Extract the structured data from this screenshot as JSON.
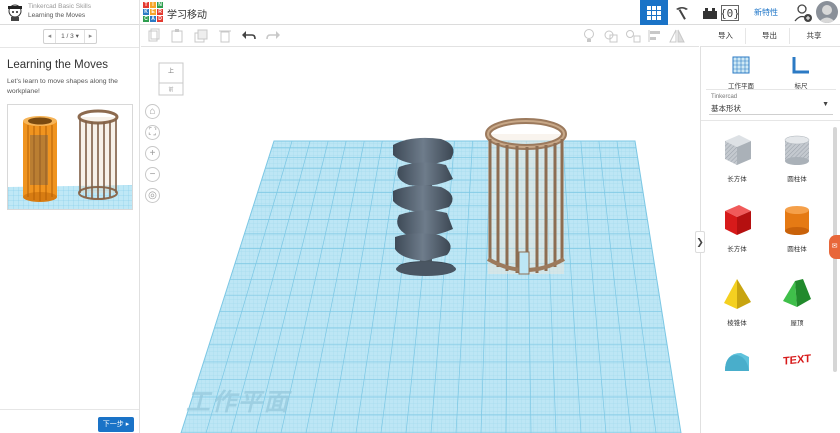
{
  "lesson": {
    "series": "Tinkercad Basic Skills",
    "name": "Learning the Moves",
    "pager": {
      "prev": "◂",
      "current": "1 / 3 ▾",
      "next": "▸"
    },
    "title": "Learning the Moves",
    "description": "Let's learn to move shapes along the workplane!",
    "next_label": "下一步 ▸"
  },
  "logo": {
    "letters": [
      "T",
      "I",
      "N",
      "K",
      "E",
      "R",
      "C",
      "A",
      "D"
    ],
    "colors": [
      "#e4392f",
      "#f7a52a",
      "#2e9e4f",
      "#2b7ac4",
      "#f7a52a",
      "#e4392f",
      "#2e9e4f",
      "#2b7ac4",
      "#e4392f"
    ]
  },
  "project": {
    "title": "学习移动"
  },
  "header": {
    "views": [
      "grid-view-icon",
      "pickaxe-icon",
      "bricks-icon",
      "code-blocks-icon"
    ],
    "tinker_label": "新特性"
  },
  "toolbar": {
    "icons": [
      "copy-icon",
      "paste-icon",
      "duplicate-icon",
      "delete-icon",
      "undo-icon",
      "redo-icon",
      "light-bulb-icon",
      "group-icon",
      "ungroup-icon",
      "align-icon",
      "mirror-icon"
    ]
  },
  "workplane": {
    "view_cube_top": "上",
    "view_cube_front": "前",
    "plane_label": "工作平面",
    "nav_buttons": [
      "home-icon",
      "fit-view-icon",
      "zoom-in-icon",
      "zoom-out-icon",
      "ortho-icon"
    ]
  },
  "right": {
    "import_label": "导入",
    "export_label": "导出",
    "share_label": "共享",
    "workplane_tool": "工作平面",
    "ruler_tool": "标尺",
    "library_small": "Tinkercad",
    "library_value": "基本形状",
    "shapes": [
      {
        "label": "长方体",
        "icon": "box-hole-icon"
      },
      {
        "label": "圆柱体",
        "icon": "cylinder-hole-icon"
      },
      {
        "label": "长方体",
        "icon": "box-icon"
      },
      {
        "label": "圆柱体",
        "icon": "cylinder-icon"
      },
      {
        "label": "棱锥体",
        "icon": "pyramid-icon"
      },
      {
        "label": "屋顶",
        "icon": "roof-icon"
      },
      {
        "label": "",
        "icon": "round-roof-icon"
      },
      {
        "label": "",
        "icon": "text-icon"
      }
    ]
  },
  "colors": {
    "accent": "#1a73c7",
    "grid": "#aee0f2",
    "grid_line": "#6cc2e3"
  }
}
